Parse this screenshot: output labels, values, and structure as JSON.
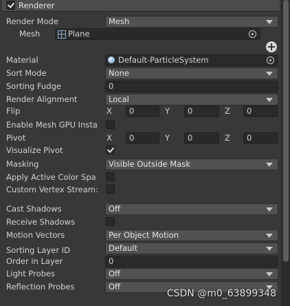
{
  "header": {
    "title": "Renderer",
    "enabled": true
  },
  "fields": {
    "render_mode": {
      "label": "Render Mode",
      "value": "Mesh"
    },
    "mesh": {
      "label": "Mesh",
      "value": "Plane"
    },
    "material": {
      "label": "Material",
      "value": "Default-ParticleSystem"
    },
    "sort_mode": {
      "label": "Sort Mode",
      "value": "None"
    },
    "sorting_fudge": {
      "label": "Sorting Fudge",
      "value": "0"
    },
    "render_alignment": {
      "label": "Render Alignment",
      "value": "Local"
    },
    "flip": {
      "label": "Flip",
      "x_label": "X",
      "x": "0",
      "y_label": "Y",
      "y": "0",
      "z_label": "Z",
      "z": "0"
    },
    "enable_mesh_gpu": {
      "label": "Enable Mesh GPU Insta",
      "checked": false
    },
    "pivot": {
      "label": "Pivot",
      "x_label": "X",
      "x": "0",
      "y_label": "Y",
      "y": "0",
      "z_label": "Z",
      "z": "0"
    },
    "visualize_pivot": {
      "label": "Visualize Pivot",
      "checked": true
    },
    "masking": {
      "label": "Masking",
      "value": "Visible Outside Mask"
    },
    "apply_active_color": {
      "label": "Apply Active Color Spa",
      "checked": false
    },
    "custom_vertex_streams": {
      "label": "Custom Vertex Stream:",
      "checked": false
    },
    "cast_shadows": {
      "label": "Cast Shadows",
      "value": "Off"
    },
    "receive_shadows": {
      "label": "Receive Shadows",
      "checked": false
    },
    "motion_vectors": {
      "label": "Motion Vectors",
      "value": "Per Object Motion"
    },
    "sorting_layer": {
      "label": "Sorting Layer ID",
      "value": "Default"
    },
    "order_in_layer": {
      "label": "Order in Layer",
      "value": "0"
    },
    "light_probes": {
      "label": "Light Probes",
      "value": "Off"
    },
    "reflection_probes": {
      "label": "Reflection Probes",
      "value": "Off"
    }
  },
  "watermark": "CSDN @m0_63899348",
  "icons": {
    "add": "plus-circle-icon",
    "picker": "object-picker-icon",
    "mesh": "mesh-grid-icon",
    "material": "material-sphere-icon"
  }
}
